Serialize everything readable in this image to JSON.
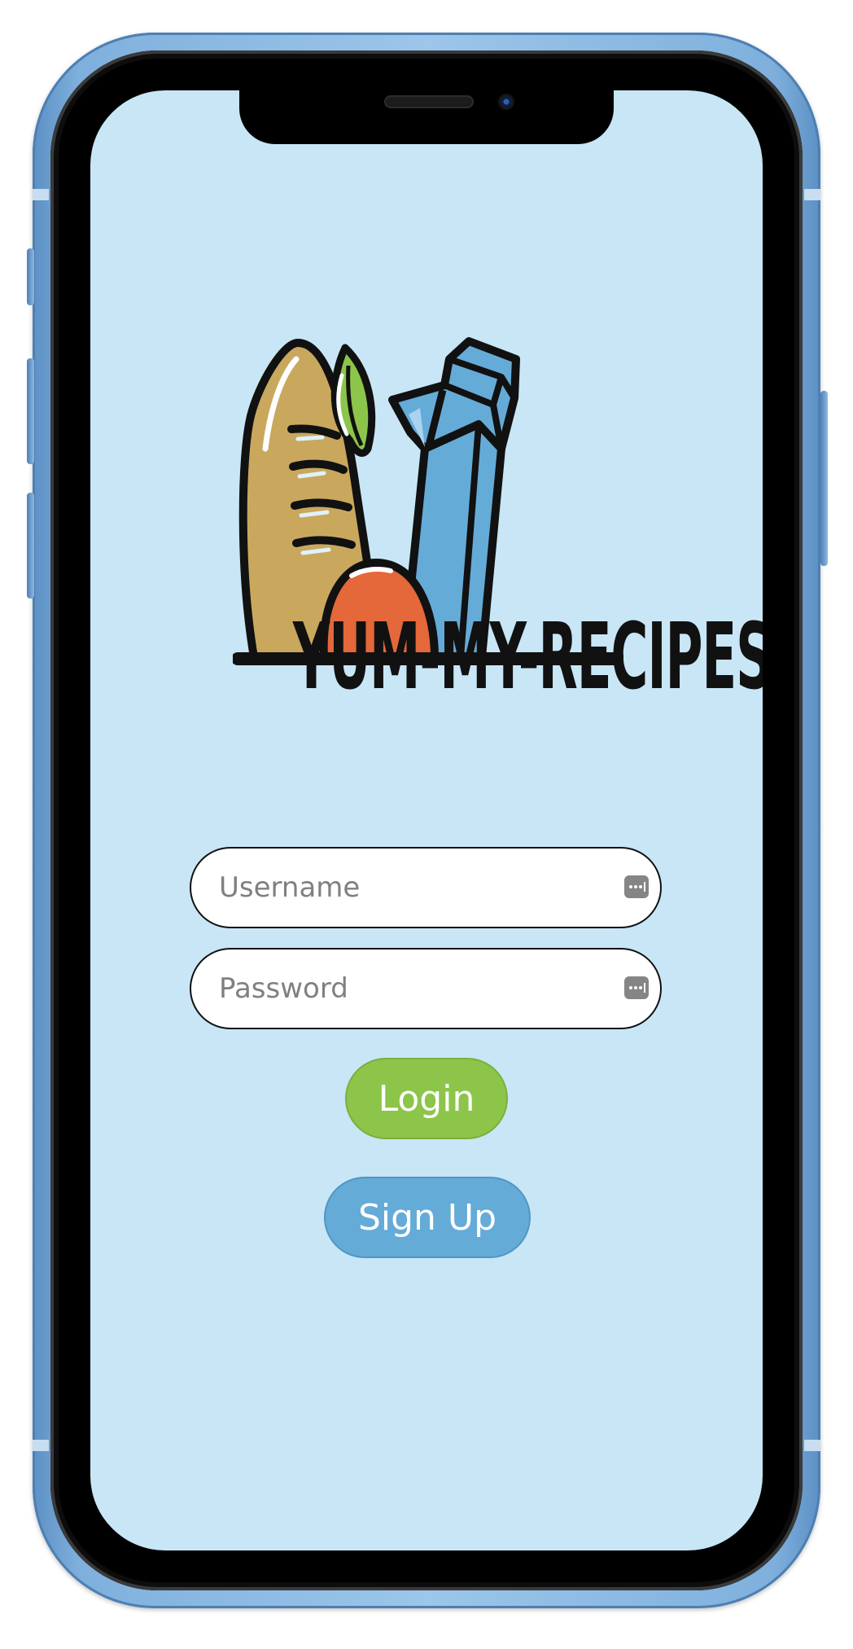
{
  "app": {
    "name": "YUM-MY-RECIPES"
  },
  "login_form": {
    "username_placeholder": "Username",
    "username_value": "",
    "password_placeholder": "Password",
    "password_value": "",
    "login_label": "Login",
    "signup_label": "Sign Up"
  },
  "icons": {
    "field_icon": "password-autofill-key-icon",
    "logo": "groceries-bread-vegetable-carton-icon"
  },
  "colors": {
    "screen_background": "#c8e6f6",
    "login_button": "#8cc54a",
    "signup_button": "#65abd8",
    "phone_frame": "#7fb0dd"
  }
}
